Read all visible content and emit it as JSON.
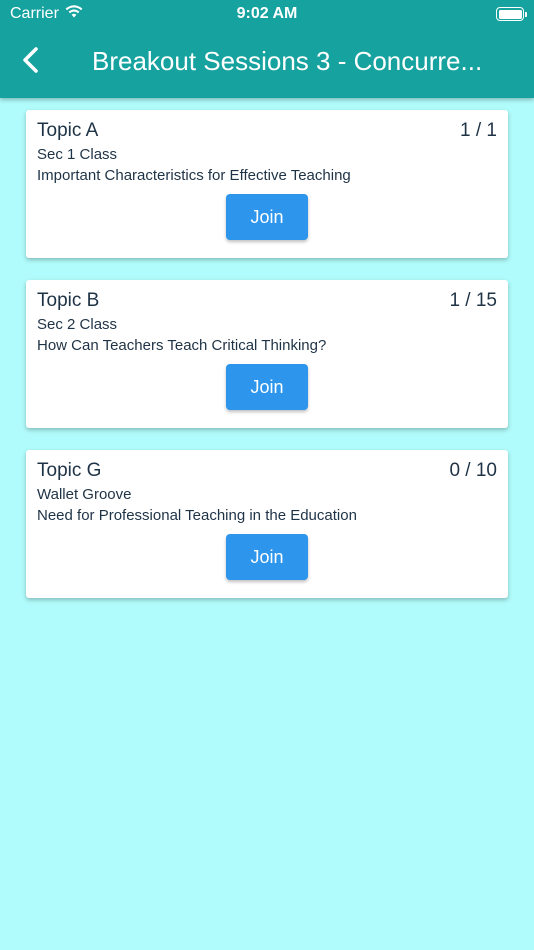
{
  "status_bar": {
    "carrier": "Carrier",
    "time": "9:02 AM",
    "wifi_icon": "wifi-icon",
    "battery_icon": "battery-full-icon"
  },
  "header": {
    "back_icon": "chevron-left-icon",
    "title": "Breakout Sessions 3 - Concurre..."
  },
  "sessions": [
    {
      "topic": "Topic A",
      "count": "1 / 1",
      "class": "Sec 1 Class",
      "description": "Important Characteristics for Effective Teaching",
      "join_label": "Join"
    },
    {
      "topic": "Topic B",
      "count": "1 / 15",
      "class": "Sec 2 Class",
      "description": "How Can Teachers Teach Critical Thinking?",
      "join_label": "Join"
    },
    {
      "topic": "Topic G",
      "count": "0 / 10",
      "class": "Wallet Groove",
      "description": "Need for Professional Teaching in the Education",
      "join_label": "Join"
    }
  ],
  "colors": {
    "header": "#16a29f",
    "background": "#b0fbfb",
    "join_button": "#2d96ec",
    "text": "#1f3346"
  }
}
